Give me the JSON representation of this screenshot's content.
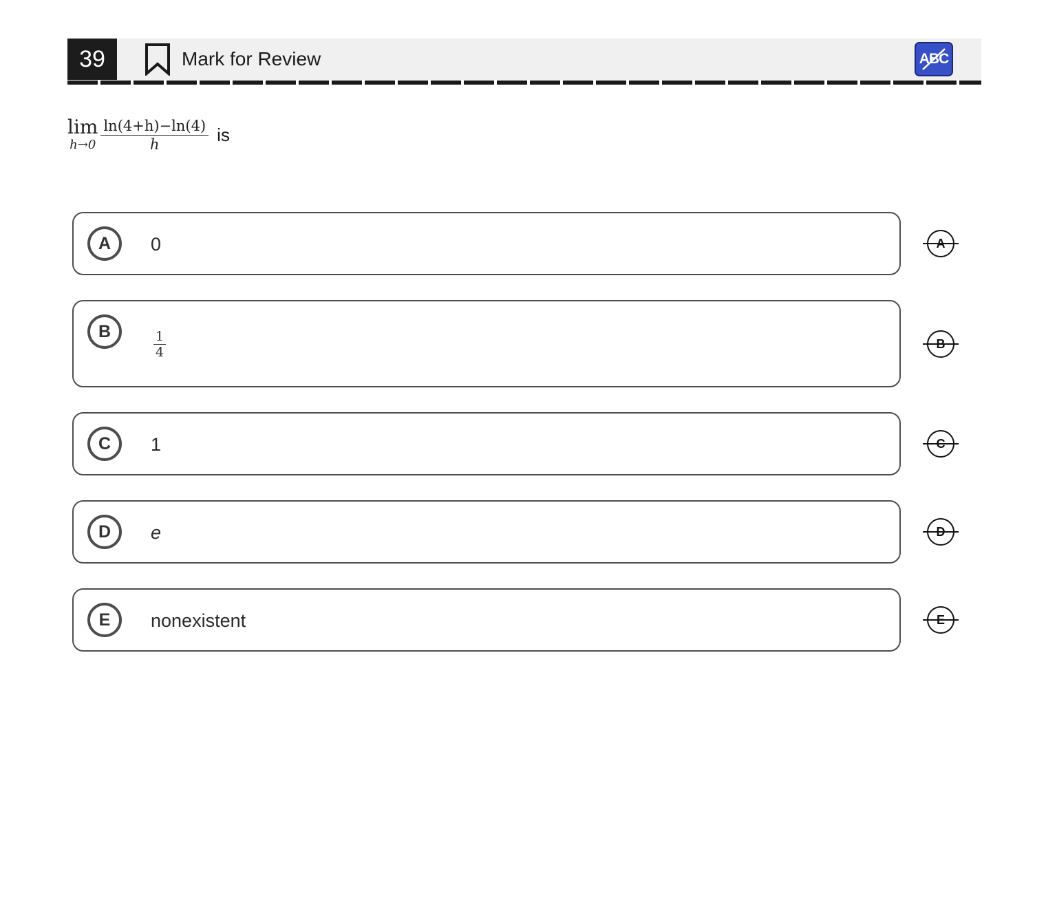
{
  "header": {
    "question_number": "39",
    "mark_label": "Mark for Review",
    "abc_label": "ABC",
    "accent_color": "#3750c8"
  },
  "question": {
    "lim_word": "lim",
    "lim_sub": "h→0",
    "numerator": "ln(4+h)−ln(4)",
    "denominator": "h",
    "suffix": "is"
  },
  "choices": [
    {
      "letter": "A",
      "text": "0"
    },
    {
      "letter": "B",
      "numerator": "1",
      "denominator": "4"
    },
    {
      "letter": "C",
      "text": "1"
    },
    {
      "letter": "D",
      "text": "e"
    },
    {
      "letter": "E",
      "text": "nonexistent"
    }
  ]
}
